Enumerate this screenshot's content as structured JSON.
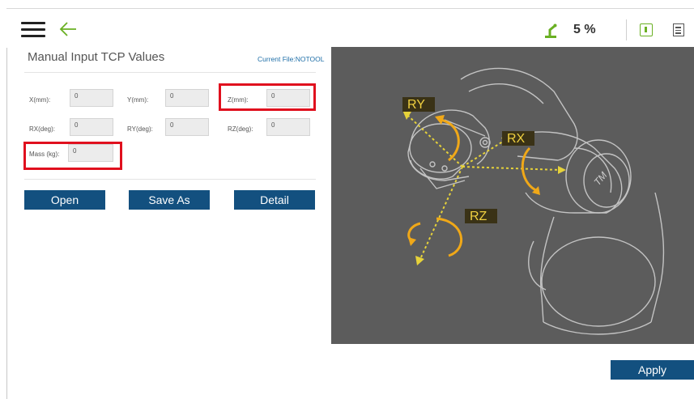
{
  "topbar": {
    "speed": "5 %",
    "icons": [
      "hamburger-menu-icon",
      "back-arrow-icon",
      "robot-status-icon",
      "info-icon",
      "log-icon"
    ],
    "accent_color": "#6ab023"
  },
  "form": {
    "title": "Manual Input TCP Values",
    "current_file": "Current File:NOTOOL",
    "fields": {
      "x": {
        "label": "X(mm):",
        "value": "0"
      },
      "y": {
        "label": "Y(mm):",
        "value": "0"
      },
      "z": {
        "label": "Z(mm):",
        "value": "0"
      },
      "rx": {
        "label": "RX(deg):",
        "value": "0"
      },
      "ry": {
        "label": "RY(deg):",
        "value": "0"
      },
      "rz": {
        "label": "RZ(deg):",
        "value": "0"
      },
      "mass": {
        "label": "Mass (kg):",
        "value": "0"
      }
    },
    "buttons": {
      "open": "Open",
      "save_as": "Save As",
      "detail": "Detail"
    }
  },
  "diagram": {
    "labels": {
      "ry": "RY",
      "rx": "RX",
      "rz": "RZ"
    },
    "colors": {
      "background": "#5c5c5c",
      "axis": "#e6d23a",
      "rotation": "#f0a818",
      "label_bg": "#3a3216"
    }
  },
  "footer": {
    "apply": "Apply"
  },
  "colors": {
    "button": "#13507f",
    "highlight": "#e0101e"
  }
}
